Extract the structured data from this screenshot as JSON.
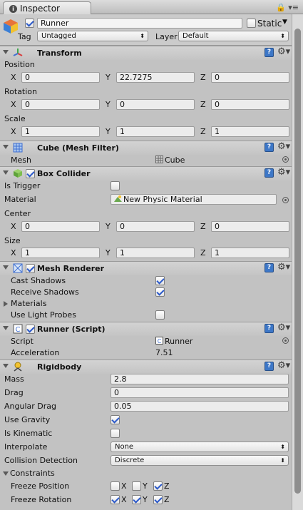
{
  "window": {
    "tab_label": "Inspector",
    "tools_glyph": "🔒 ▾≡"
  },
  "gameobject": {
    "name": "Runner",
    "active": true,
    "static_label": "Static",
    "static_checked": false,
    "tag_label": "Tag",
    "tag_value": "Untagged",
    "layer_label": "Layer",
    "layer_value": "Default"
  },
  "transform": {
    "title": "Transform",
    "position_label": "Position",
    "position": {
      "x": "0",
      "y": "22.7275",
      "z": "0"
    },
    "rotation_label": "Rotation",
    "rotation": {
      "x": "0",
      "y": "0",
      "z": "0"
    },
    "scale_label": "Scale",
    "scale": {
      "x": "1",
      "y": "1",
      "z": "1"
    }
  },
  "axis": {
    "x": "X",
    "y": "Y",
    "z": "Z"
  },
  "mesh_filter": {
    "title": "Cube (Mesh Filter)",
    "mesh_label": "Mesh",
    "mesh_value": "Cube"
  },
  "box_collider": {
    "title": "Box Collider",
    "enabled": true,
    "is_trigger_label": "Is Trigger",
    "is_trigger": false,
    "material_label": "Material",
    "material_value": "New Physic Material",
    "center_label": "Center",
    "center": {
      "x": "0",
      "y": "0",
      "z": "0"
    },
    "size_label": "Size",
    "size": {
      "x": "1",
      "y": "1",
      "z": "1"
    }
  },
  "mesh_renderer": {
    "title": "Mesh Renderer",
    "enabled": true,
    "cast_shadows_label": "Cast Shadows",
    "cast_shadows": true,
    "receive_shadows_label": "Receive Shadows",
    "receive_shadows": true,
    "materials_label": "Materials",
    "use_light_probes_label": "Use Light Probes",
    "use_light_probes": false
  },
  "runner_script": {
    "title": "Runner (Script)",
    "enabled": true,
    "script_label": "Script",
    "script_value": "Runner",
    "acceleration_label": "Acceleration",
    "acceleration_value": "7.51"
  },
  "rigidbody": {
    "title": "Rigidbody",
    "mass_label": "Mass",
    "mass": "2.8",
    "drag_label": "Drag",
    "drag": "0",
    "angular_drag_label": "Angular Drag",
    "angular_drag": "0.05",
    "use_gravity_label": "Use Gravity",
    "use_gravity": true,
    "is_kinematic_label": "Is Kinematic",
    "is_kinematic": false,
    "interpolate_label": "Interpolate",
    "interpolate_value": "None",
    "collision_detection_label": "Collision Detection",
    "collision_detection_value": "Discrete",
    "constraints_label": "Constraints",
    "freeze_position_label": "Freeze Position",
    "freeze_position": {
      "x": false,
      "y": false,
      "z": true
    },
    "freeze_rotation_label": "Freeze Rotation",
    "freeze_rotation": {
      "x": true,
      "y": true,
      "z": true
    }
  },
  "icons": {
    "help": "?",
    "gear": "⚙"
  },
  "colors": {
    "accent_blue": "#3d77c7",
    "checkmark": "#2a58c9",
    "panel_bg": "#c2c2c2"
  }
}
